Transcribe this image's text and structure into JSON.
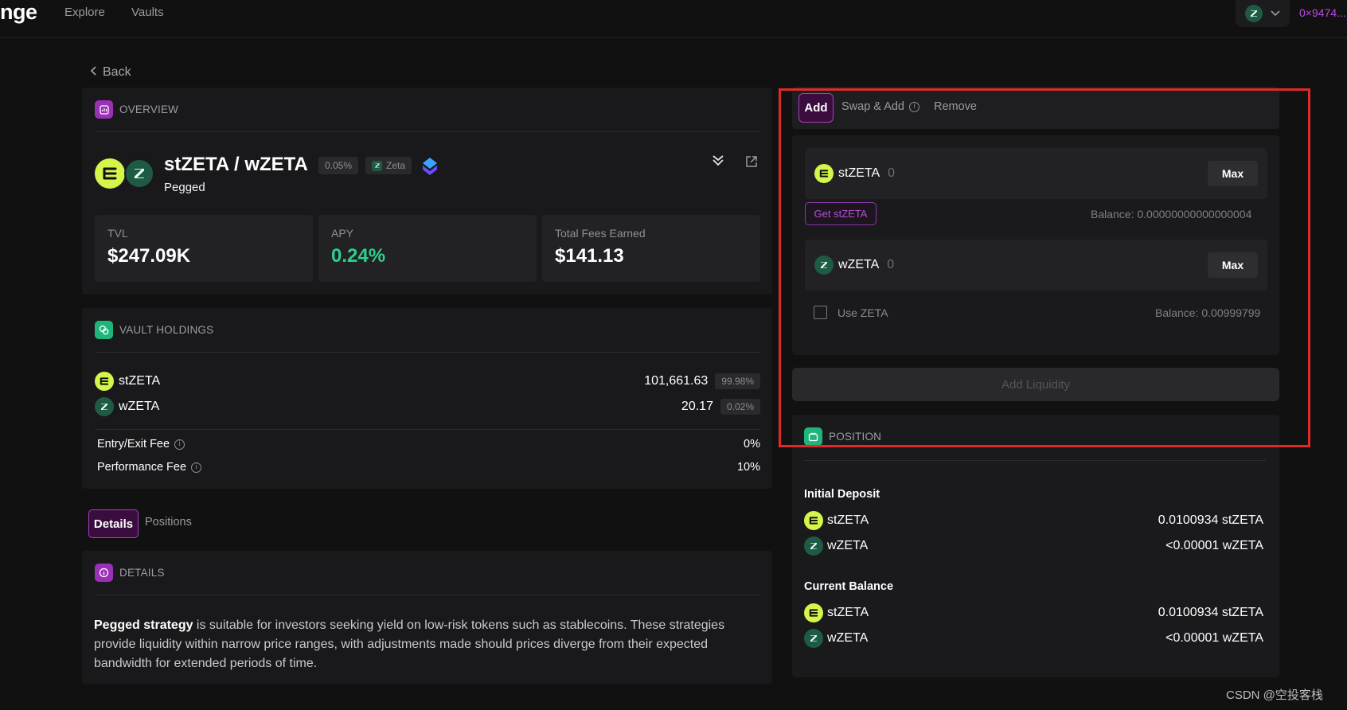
{
  "nav": {
    "brand": "nge",
    "links": [
      "Explore",
      "Vaults"
    ],
    "address": "0×9474...",
    "network_icon": "zeta-icon"
  },
  "back_label": "Back",
  "overview": {
    "section_title": "OVERVIEW",
    "pair_title": "stZETA / wZETA",
    "fee_badge": "0.05%",
    "chain_badge": "Zeta",
    "strategy": "Pegged",
    "stats": [
      {
        "label": "TVL",
        "value": "$247.09K"
      },
      {
        "label": "APY",
        "value": "0.24%"
      },
      {
        "label": "Total Fees Earned",
        "value": "$141.13"
      }
    ]
  },
  "holdings": {
    "section_title": "VAULT HOLDINGS",
    "rows": [
      {
        "token": "stZETA",
        "amount": "101,661.63",
        "pct": "99.98%"
      },
      {
        "token": "wZETA",
        "amount": "20.17",
        "pct": "0.02%"
      }
    ],
    "fees": [
      {
        "label": "Entry/Exit Fee",
        "value": "0%"
      },
      {
        "label": "Performance Fee",
        "value": "10%"
      }
    ]
  },
  "lower_tabs": {
    "active": "Details",
    "other": "Positions"
  },
  "details": {
    "section_title": "DETAILS",
    "lead": "Pegged strategy",
    "body": " is suitable for investors seeking yield on low-risk tokens such as stablecoins. These strategies provide liquidity within narrow price ranges, with adjustments made should prices diverge from their expected bandwidth for extended periods of time."
  },
  "liquidity": {
    "tabs": {
      "add": "Add",
      "swap_add": "Swap & Add",
      "remove": "Remove"
    },
    "input1": {
      "token": "stZETA",
      "value": "0",
      "max": "Max",
      "get": "Get stZETA",
      "balance": "Balance: 0.00000000000000004"
    },
    "input2": {
      "token": "wZETA",
      "value": "0",
      "max": "Max"
    },
    "use_zeta": "Use ZETA",
    "balance2": "Balance: 0.00999799",
    "submit": "Add Liquidity"
  },
  "position": {
    "section_title": "POSITION",
    "initial_label": "Initial Deposit",
    "initial": [
      {
        "token": "stZETA",
        "amount": "0.0100934 stZETA"
      },
      {
        "token": "wZETA",
        "amount": "<0.00001 wZETA"
      }
    ],
    "current_label": "Current Balance",
    "current": [
      {
        "token": "stZETA",
        "amount": "0.0100934 stZETA"
      },
      {
        "token": "wZETA",
        "amount": "<0.00001 wZETA"
      }
    ]
  },
  "watermark": "CSDN @空投客栈",
  "colors": {
    "accent_purple": "#a43fc2",
    "apy_green": "#2ecf8e",
    "highlight_red": "#e02a2a",
    "stzeta_token": "#d4f54a",
    "wzeta_token": "#1f5a45"
  }
}
